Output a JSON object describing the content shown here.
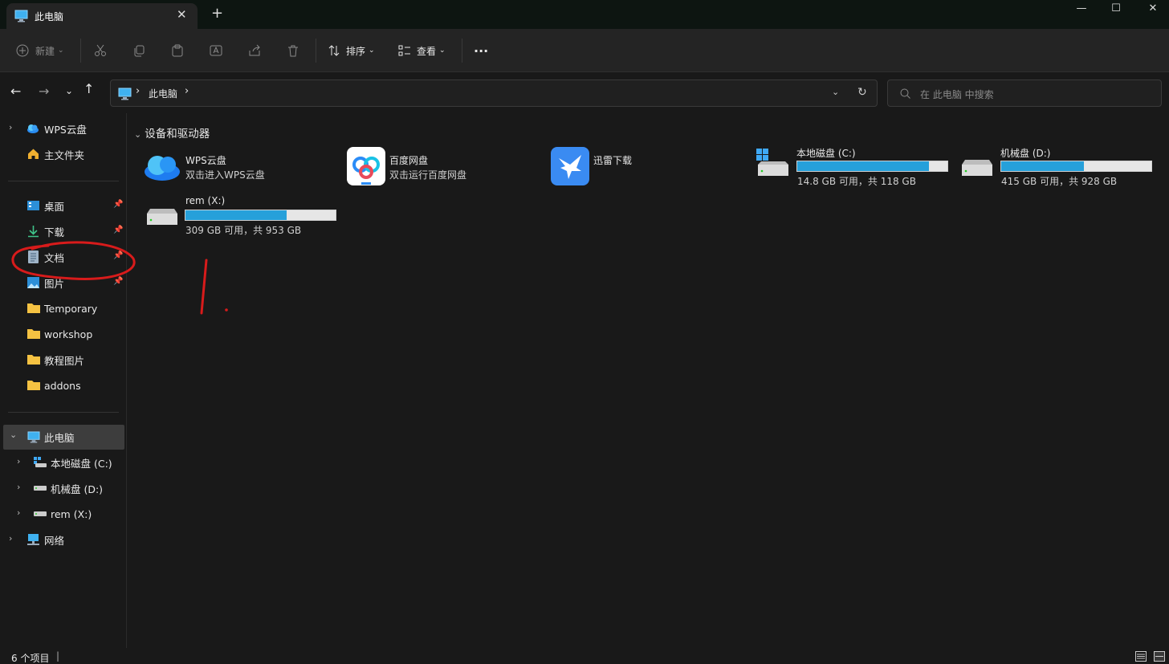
{
  "window": {
    "tab_title": "此电脑",
    "new_tab": "+",
    "controls": {
      "minimize": "—",
      "maximize": "☐",
      "close": "✕"
    }
  },
  "toolbar": {
    "new_label": "新建",
    "sort_label": "排序",
    "view_label": "查看",
    "more_label": "···"
  },
  "address": {
    "crumb": "此电脑",
    "separator": "›",
    "search_placeholder": "在 此电脑 中搜索"
  },
  "sidebar": {
    "wps": "WPS云盘",
    "home": "主文件夹",
    "quick": [
      {
        "label": "桌面",
        "pinned": true
      },
      {
        "label": "下载",
        "pinned": true
      },
      {
        "label": "文档",
        "pinned": true
      },
      {
        "label": "图片",
        "pinned": true
      },
      {
        "label": "Temporary"
      },
      {
        "label": "workshop"
      },
      {
        "label": "教程图片"
      },
      {
        "label": "addons"
      }
    ],
    "this_pc": "此电脑",
    "drives": [
      "本地磁盘 (C:)",
      "机械盘 (D:)",
      "rem (X:)"
    ],
    "network": "网络"
  },
  "main": {
    "group_title": "设备和驱动器",
    "apps": [
      {
        "name": "WPS云盘",
        "sub": "双击进入WPS云盘"
      },
      {
        "name": "百度网盘",
        "sub": "双击运行百度网盘"
      },
      {
        "name": "迅雷下载",
        "sub": ""
      }
    ],
    "drives": [
      {
        "name": "本地磁盘 (C:)",
        "sub": "14.8 GB 可用，共 118 GB",
        "used_fraction": 0.875
      },
      {
        "name": "机械盘 (D:)",
        "sub": "415 GB 可用，共 928 GB",
        "used_fraction": 0.553
      },
      {
        "name": "rem (X:)",
        "sub": "309 GB 可用，共 953 GB",
        "used_fraction": 0.676
      }
    ]
  },
  "status": {
    "count": "6 个项目",
    "divider": "|"
  },
  "colors": {
    "accent": "#26a0da",
    "annotation": "#d81b1b",
    "background": "#191919"
  }
}
